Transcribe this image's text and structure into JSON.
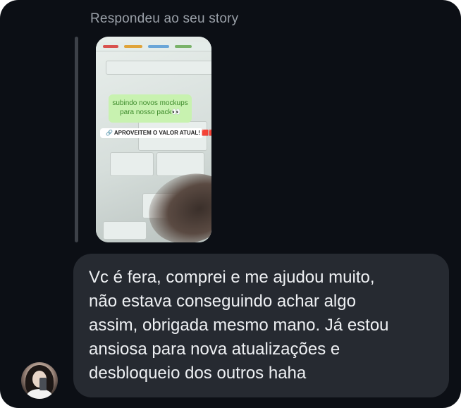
{
  "reply_context": {
    "label": "Respondeu ao seu story"
  },
  "story_preview": {
    "sticker_text_line1": "subindo novos mockups",
    "sticker_text_line2": "para nosso pack👀",
    "cta_text": "🔗 APROVEITEM O VALOR ATUAL! 🟥🟥"
  },
  "message": {
    "lines": [
      "Vc é fera, comprei e me ajudou muito,",
      "não estava conseguindo achar algo",
      "assim, obrigada mesmo mano. Já estou",
      "ansiosa para nova atualizações e",
      "desbloqueio dos outros haha"
    ]
  },
  "colors": {
    "background": "#0c0f15",
    "bubble": "#262a31",
    "text": "#eef0f3",
    "muted_text": "#9aa0a8"
  }
}
